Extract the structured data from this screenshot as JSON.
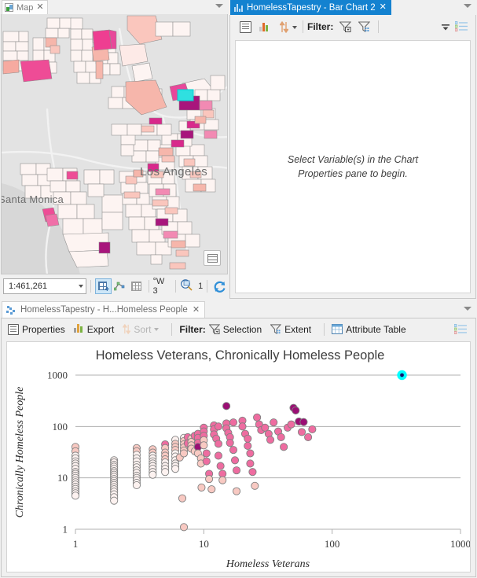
{
  "map_panel": {
    "tab": {
      "label": "Map",
      "icon": "map-icon",
      "close": "✕"
    },
    "labels": {
      "los_angeles": "Los Angeles",
      "santa_monica": "Santa Monica"
    },
    "toolbar": {
      "scale_value": "1:461,261",
      "add_feature": "add-feature-icon",
      "edit": "edit-vertices-icon",
      "grid": "table-grid-icon",
      "coord_label": "°W 3",
      "select_count": "1",
      "refresh": "↻"
    },
    "basemap_button": "basemap-gallery-icon"
  },
  "chart_panel": {
    "tab": {
      "label": "HomelessTapestry - Bar Chart 2",
      "icon": "bar-chart-icon",
      "close": "✕"
    },
    "toolbar": {
      "properties": "chart-properties-icon",
      "bar_chart": "bar-chart-icon",
      "sort": "sort-updown-icon",
      "filter_label": "Filter:",
      "filter_selection": "filter-selection-icon",
      "filter_extent": "filter-extent-icon",
      "legend": "legend-list-icon",
      "overflow": "toolbar-overflow-icon"
    },
    "placeholder": "Select Variable(s) in the Chart Properties pane to begin."
  },
  "bottom_panel": {
    "tab": {
      "label": "HomelessTapestry - H...Homeless People",
      "icon": "scatter-plot-icon",
      "close": "✕"
    },
    "toolbar": {
      "properties": "Properties",
      "export": "Export",
      "sort": "Sort",
      "filter_label": "Filter:",
      "selection": "Selection",
      "extent": "Extent",
      "attribute_table": "Attribute Table",
      "legend": "legend-list-icon"
    }
  },
  "chart_data": {
    "type": "scatter",
    "title": "Homeless Veterans, Chronically Homeless People",
    "xlabel": "Homeless Veterans",
    "ylabel": "Chronically Homeless People",
    "xscale": "log",
    "yscale": "log",
    "xlim": [
      1,
      1000
    ],
    "ylim": [
      1,
      1000
    ],
    "xticks": [
      1,
      10,
      100,
      1000
    ],
    "xtick_labels": [
      "1",
      "10",
      "100",
      "1000"
    ],
    "yticks": [
      1,
      10,
      100,
      1000
    ],
    "ytick_labels": [
      "1",
      "10",
      "100",
      "1000"
    ],
    "grid": "horizontal",
    "point_colors": {
      "low": "#fdf2f0",
      "mid_low": "#f8c9c2",
      "mid": "#ee6ca0",
      "high": "#d4258f",
      "very_high": "#9b0e74",
      "selected": "#00ffff",
      "stroke": "#808080"
    },
    "selected_point": {
      "x": 350,
      "y": 1000,
      "color": "#00ffff"
    },
    "points": [
      {
        "x": 1,
        "y": 40,
        "c": "#f8c9c2"
      },
      {
        "x": 1,
        "y": 33,
        "c": "#f8c9c2"
      },
      {
        "x": 1,
        "y": 27,
        "c": "#fdf2f0"
      },
      {
        "x": 1,
        "y": 24,
        "c": "#fdf2f0"
      },
      {
        "x": 1,
        "y": 21,
        "c": "#fdf2f0"
      },
      {
        "x": 1,
        "y": 19,
        "c": "#fdf2f0"
      },
      {
        "x": 1,
        "y": 17,
        "c": "#fdf2f0"
      },
      {
        "x": 1,
        "y": 15,
        "c": "#fdf2f0"
      },
      {
        "x": 1,
        "y": 13,
        "c": "#fdf2f0"
      },
      {
        "x": 1,
        "y": 12,
        "c": "#fdf2f0"
      },
      {
        "x": 1,
        "y": 11,
        "c": "#fdf2f0"
      },
      {
        "x": 1,
        "y": 10,
        "c": "#fdf2f0"
      },
      {
        "x": 1,
        "y": 9,
        "c": "#fdf2f0"
      },
      {
        "x": 1,
        "y": 8.2,
        "c": "#fdf2f0"
      },
      {
        "x": 1,
        "y": 7.4,
        "c": "#fdf2f0"
      },
      {
        "x": 1,
        "y": 6.7,
        "c": "#fdf2f0"
      },
      {
        "x": 1,
        "y": 6.1,
        "c": "#fdf2f0"
      },
      {
        "x": 1,
        "y": 5.5,
        "c": "#fdf2f0"
      },
      {
        "x": 1,
        "y": 5.0,
        "c": "#fdf2f0"
      },
      {
        "x": 1,
        "y": 4.5,
        "c": "#fdf2f0"
      },
      {
        "x": 2,
        "y": 22,
        "c": "#fdf2f0"
      },
      {
        "x": 2,
        "y": 20,
        "c": "#fdf2f0"
      },
      {
        "x": 2,
        "y": 18,
        "c": "#fdf2f0"
      },
      {
        "x": 2,
        "y": 16.5,
        "c": "#fdf2f0"
      },
      {
        "x": 2,
        "y": 15,
        "c": "#fdf2f0"
      },
      {
        "x": 2,
        "y": 13.5,
        "c": "#fdf2f0"
      },
      {
        "x": 2,
        "y": 12.5,
        "c": "#fdf2f0"
      },
      {
        "x": 2,
        "y": 11.5,
        "c": "#fdf2f0"
      },
      {
        "x": 2,
        "y": 10.5,
        "c": "#fdf2f0"
      },
      {
        "x": 2,
        "y": 9.5,
        "c": "#fdf2f0"
      },
      {
        "x": 2,
        "y": 8.7,
        "c": "#fdf2f0"
      },
      {
        "x": 2,
        "y": 8,
        "c": "#fdf2f0"
      },
      {
        "x": 2,
        "y": 7.3,
        "c": "#fdf2f0"
      },
      {
        "x": 2,
        "y": 6.6,
        "c": "#fdf2f0"
      },
      {
        "x": 2,
        "y": 6,
        "c": "#fdf2f0"
      },
      {
        "x": 2,
        "y": 5.4,
        "c": "#fdf2f0"
      },
      {
        "x": 2,
        "y": 4.8,
        "c": "#fdf2f0"
      },
      {
        "x": 2,
        "y": 4.2,
        "c": "#fdf2f0"
      },
      {
        "x": 2,
        "y": 3.6,
        "c": "#fdf2f0"
      },
      {
        "x": 3,
        "y": 38,
        "c": "#f8c9c2"
      },
      {
        "x": 3,
        "y": 33,
        "c": "#f8c9c2"
      },
      {
        "x": 3,
        "y": 28,
        "c": "#fdf2f0"
      },
      {
        "x": 3,
        "y": 24,
        "c": "#fdf2f0"
      },
      {
        "x": 3,
        "y": 21,
        "c": "#fdf2f0"
      },
      {
        "x": 3,
        "y": 18,
        "c": "#fdf2f0"
      },
      {
        "x": 3,
        "y": 16,
        "c": "#fdf2f0"
      },
      {
        "x": 3,
        "y": 14,
        "c": "#fdf2f0"
      },
      {
        "x": 3,
        "y": 12.5,
        "c": "#fdf2f0"
      },
      {
        "x": 3,
        "y": 11,
        "c": "#fdf2f0"
      },
      {
        "x": 3,
        "y": 10,
        "c": "#fdf2f0"
      },
      {
        "x": 3,
        "y": 9,
        "c": "#fdf2f0"
      },
      {
        "x": 3,
        "y": 8,
        "c": "#fdf2f0"
      },
      {
        "x": 3,
        "y": 7.2,
        "c": "#fdf2f0"
      },
      {
        "x": 4,
        "y": 36,
        "c": "#f8c9c2"
      },
      {
        "x": 4,
        "y": 31,
        "c": "#f8c9c2"
      },
      {
        "x": 4,
        "y": 27,
        "c": "#fdf2f0"
      },
      {
        "x": 4,
        "y": 24,
        "c": "#fdf2f0"
      },
      {
        "x": 4,
        "y": 21,
        "c": "#fdf2f0"
      },
      {
        "x": 4,
        "y": 19,
        "c": "#fdf2f0"
      },
      {
        "x": 4,
        "y": 17,
        "c": "#fdf2f0"
      },
      {
        "x": 4,
        "y": 15,
        "c": "#fdf2f0"
      },
      {
        "x": 4,
        "y": 13,
        "c": "#fdf2f0"
      },
      {
        "x": 4,
        "y": 11.5,
        "c": "#fdf2f0"
      },
      {
        "x": 5,
        "y": 45,
        "c": "#ee6ca0"
      },
      {
        "x": 5,
        "y": 38,
        "c": "#f8c9c2"
      },
      {
        "x": 5,
        "y": 31,
        "c": "#f8c9c2"
      },
      {
        "x": 5,
        "y": 27,
        "c": "#f8c9c2"
      },
      {
        "x": 5,
        "y": 23,
        "c": "#f8c9c2"
      },
      {
        "x": 5,
        "y": 20,
        "c": "#fdf2f0"
      },
      {
        "x": 5,
        "y": 17,
        "c": "#fdf2f0"
      },
      {
        "x": 5,
        "y": 15,
        "c": "#fdf2f0"
      },
      {
        "x": 5,
        "y": 13,
        "c": "#fdf2f0"
      },
      {
        "x": 6,
        "y": 55,
        "c": "#fdf2f0"
      },
      {
        "x": 6,
        "y": 46,
        "c": "#f8c9c2"
      },
      {
        "x": 6,
        "y": 40,
        "c": "#f8c9c2"
      },
      {
        "x": 6,
        "y": 35,
        "c": "#f8c9c2"
      },
      {
        "x": 6,
        "y": 30,
        "c": "#fdf2f0"
      },
      {
        "x": 6,
        "y": 26,
        "c": "#fdf2f0"
      },
      {
        "x": 6,
        "y": 22,
        "c": "#fdf2f0"
      },
      {
        "x": 6,
        "y": 19,
        "c": "#fdf2f0"
      },
      {
        "x": 6,
        "y": 17,
        "c": "#fdf2f0"
      },
      {
        "x": 6,
        "y": 15,
        "c": "#fdf2f0"
      },
      {
        "x": 6.5,
        "y": 25,
        "c": "#f8c9c2"
      },
      {
        "x": 6.8,
        "y": 4,
        "c": "#f8c9c2"
      },
      {
        "x": 7,
        "y": 1.1,
        "c": "#f8c9c2"
      },
      {
        "x": 7,
        "y": 60,
        "c": "#fdf2f0"
      },
      {
        "x": 7,
        "y": 52,
        "c": "#f8c9c2"
      },
      {
        "x": 7,
        "y": 45,
        "c": "#f8c9c2"
      },
      {
        "x": 7,
        "y": 39,
        "c": "#f8c9c2"
      },
      {
        "x": 7,
        "y": 34,
        "c": "#f8c9c2"
      },
      {
        "x": 7,
        "y": 30,
        "c": "#f8c9c2"
      },
      {
        "x": 7.5,
        "y": 62,
        "c": "#ee6ca0"
      },
      {
        "x": 7.5,
        "y": 47,
        "c": "#ee6ca0"
      },
      {
        "x": 8,
        "y": 58,
        "c": "#f8c9c2"
      },
      {
        "x": 8,
        "y": 50,
        "c": "#f8c9c2"
      },
      {
        "x": 8,
        "y": 43,
        "c": "#f8c9c2"
      },
      {
        "x": 8,
        "y": 37,
        "c": "#f8c9c2"
      },
      {
        "x": 8.5,
        "y": 66,
        "c": "#ee6ca0"
      },
      {
        "x": 8.5,
        "y": 33,
        "c": "#f8c9c2"
      },
      {
        "x": 9,
        "y": 72,
        "c": "#ee6ca0"
      },
      {
        "x": 9,
        "y": 60,
        "c": "#ee6ca0"
      },
      {
        "x": 9,
        "y": 48,
        "c": "#ee6ca0"
      },
      {
        "x": 9,
        "y": 40,
        "c": "#9b0e74"
      },
      {
        "x": 9,
        "y": 30,
        "c": "#f8c9c2"
      },
      {
        "x": 9.5,
        "y": 24,
        "c": "#f8c9c2"
      },
      {
        "x": 9.5,
        "y": 19,
        "c": "#f8c9c2"
      },
      {
        "x": 9.6,
        "y": 6.5,
        "c": "#f8c9c2"
      },
      {
        "x": 10,
        "y": 95,
        "c": "#ee6ca0"
      },
      {
        "x": 10,
        "y": 80,
        "c": "#ee6ca0"
      },
      {
        "x": 10,
        "y": 66,
        "c": "#ee6ca0"
      },
      {
        "x": 10,
        "y": 54,
        "c": "#f8c9c2"
      },
      {
        "x": 10,
        "y": 43,
        "c": "#f8c9c2"
      },
      {
        "x": 10.5,
        "y": 30,
        "c": "#ee6ca0"
      },
      {
        "x": 10.5,
        "y": 21,
        "c": "#ee6ca0"
      },
      {
        "x": 11,
        "y": 12,
        "c": "#ee6ca0"
      },
      {
        "x": 11,
        "y": 9.5,
        "c": "#f8c9c2"
      },
      {
        "x": 11.5,
        "y": 6,
        "c": "#f8c9c2"
      },
      {
        "x": 12,
        "y": 105,
        "c": "#ee6ca0"
      },
      {
        "x": 12,
        "y": 88,
        "c": "#ee6ca0"
      },
      {
        "x": 12,
        "y": 70,
        "c": "#ee6ca0"
      },
      {
        "x": 12.5,
        "y": 58,
        "c": "#ee6ca0"
      },
      {
        "x": 13,
        "y": 100,
        "c": "#ee6ca0"
      },
      {
        "x": 13,
        "y": 46,
        "c": "#ee6ca0"
      },
      {
        "x": 13,
        "y": 27,
        "c": "#ee6ca0"
      },
      {
        "x": 13.5,
        "y": 17,
        "c": "#ee6ca0"
      },
      {
        "x": 14,
        "y": 12,
        "c": "#ee6ca0"
      },
      {
        "x": 14,
        "y": 9,
        "c": "#f8c9c2"
      },
      {
        "x": 15,
        "y": 250,
        "c": "#9b0e74"
      },
      {
        "x": 15,
        "y": 115,
        "c": "#ee6ca0"
      },
      {
        "x": 15,
        "y": 92,
        "c": "#ee6ca0"
      },
      {
        "x": 15.5,
        "y": 75,
        "c": "#ee6ca0"
      },
      {
        "x": 16,
        "y": 62,
        "c": "#ee6ca0"
      },
      {
        "x": 16,
        "y": 48,
        "c": "#ee6ca0"
      },
      {
        "x": 17,
        "y": 120,
        "c": "#ee6ca0"
      },
      {
        "x": 17,
        "y": 35,
        "c": "#ee6ca0"
      },
      {
        "x": 17.5,
        "y": 22,
        "c": "#ee6ca0"
      },
      {
        "x": 18,
        "y": 14,
        "c": "#ee6ca0"
      },
      {
        "x": 18,
        "y": 5.5,
        "c": "#f8c9c2"
      },
      {
        "x": 20,
        "y": 130,
        "c": "#ee6ca0"
      },
      {
        "x": 20,
        "y": 100,
        "c": "#ee6ca0"
      },
      {
        "x": 21,
        "y": 72,
        "c": "#ee6ca0"
      },
      {
        "x": 22,
        "y": 58,
        "c": "#ee6ca0"
      },
      {
        "x": 22,
        "y": 42,
        "c": "#ee6ca0"
      },
      {
        "x": 23,
        "y": 30,
        "c": "#ee6ca0"
      },
      {
        "x": 23,
        "y": 19,
        "c": "#ee6ca0"
      },
      {
        "x": 24,
        "y": 13,
        "c": "#ee6ca0"
      },
      {
        "x": 25,
        "y": 7,
        "c": "#f8c9c2"
      },
      {
        "x": 26,
        "y": 150,
        "c": "#ee6ca0"
      },
      {
        "x": 27,
        "y": 110,
        "c": "#ee6ca0"
      },
      {
        "x": 28,
        "y": 85,
        "c": "#ee6ca0"
      },
      {
        "x": 30,
        "y": 95,
        "c": "#ee6ca0"
      },
      {
        "x": 32,
        "y": 72,
        "c": "#ee6ca0"
      },
      {
        "x": 33,
        "y": 55,
        "c": "#ee6ca0"
      },
      {
        "x": 35,
        "y": 120,
        "c": "#ee6ca0"
      },
      {
        "x": 38,
        "y": 80,
        "c": "#ee6ca0"
      },
      {
        "x": 40,
        "y": 62,
        "c": "#ee6ca0"
      },
      {
        "x": 42,
        "y": 40,
        "c": "#ee6ca0"
      },
      {
        "x": 45,
        "y": 95,
        "c": "#ee6ca0"
      },
      {
        "x": 48,
        "y": 110,
        "c": "#ee6ca0"
      },
      {
        "x": 50,
        "y": 230,
        "c": "#9b0e74"
      },
      {
        "x": 52,
        "y": 205,
        "c": "#9b0e74"
      },
      {
        "x": 55,
        "y": 125,
        "c": "#9b0e74"
      },
      {
        "x": 60,
        "y": 122,
        "c": "#9b0e74"
      },
      {
        "x": 58,
        "y": 78,
        "c": "#ee6ca0"
      },
      {
        "x": 65,
        "y": 62,
        "c": "#ee6ca0"
      },
      {
        "x": 70,
        "y": 88,
        "c": "#ee6ca0"
      }
    ]
  }
}
